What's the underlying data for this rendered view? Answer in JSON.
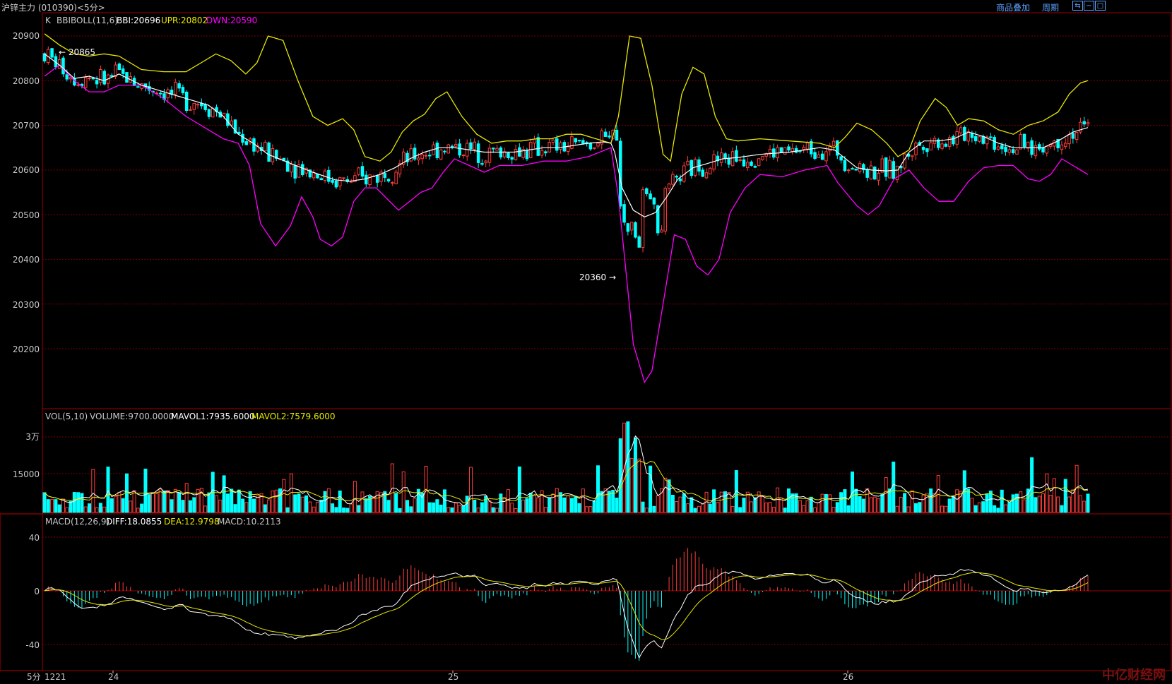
{
  "header": {
    "title": "沪锌主力 (010390)<5分>",
    "overlay_label": "商品叠加",
    "period_label": "周期"
  },
  "colors": {
    "up": "#ff3c3c",
    "down": "#00ffff",
    "bbi": "#ffffff",
    "upr": "#e8e800",
    "dwn": "#ff00ff",
    "grid": "#7a0000",
    "frame": "#a00000"
  },
  "price_panel": {
    "k_label": "K",
    "indicator": "BBIBOLL(11,6)",
    "bbi": "BBI:20696",
    "upr": "UPR:20802",
    "dwn": "DWN:20590",
    "ticks": [
      "20900",
      "20800",
      "20700",
      "20600",
      "20500",
      "20400",
      "20300",
      "20200"
    ],
    "high_mark": "20865",
    "low_mark": "20360"
  },
  "volume_panel": {
    "indicator": "VOL(5,10)",
    "volume": "VOLUME:9700.0000",
    "mavol1": "MAVOL1:7935.6000",
    "mavol2": "MAVOL2:7579.6000",
    "ticks": [
      "3万",
      "15000"
    ]
  },
  "macd_panel": {
    "indicator": "MACD(12,26,9)",
    "diff": "DIFF:18.0855",
    "dea": "DEA:12.9798",
    "macd": "MACD:10.2113",
    "ticks": [
      "40",
      "0",
      "-40"
    ]
  },
  "x_axis": {
    "period": "5分",
    "labels": [
      "1221",
      "24",
      "25",
      "26"
    ]
  },
  "watermark": "中亿财经网",
  "chart_data": {
    "type": "candlestick",
    "y_range": [
      20110,
      20995
    ],
    "bbi_path": [
      [
        0,
        20860
      ],
      [
        20,
        20835
      ],
      [
        40,
        20805
      ],
      [
        60,
        20810
      ],
      [
        80,
        20800
      ],
      [
        100,
        20815
      ],
      [
        130,
        20790
      ],
      [
        160,
        20775
      ],
      [
        190,
        20760
      ],
      [
        220,
        20745
      ],
      [
        240,
        20720
      ],
      [
        260,
        20680
      ],
      [
        280,
        20660
      ],
      [
        300,
        20635
      ],
      [
        330,
        20615
      ],
      [
        360,
        20595
      ],
      [
        390,
        20578
      ],
      [
        410,
        20575
      ],
      [
        430,
        20580
      ],
      [
        450,
        20590
      ],
      [
        470,
        20605
      ],
      [
        490,
        20625
      ],
      [
        510,
        20640
      ],
      [
        530,
        20650
      ],
      [
        550,
        20650
      ],
      [
        570,
        20645
      ],
      [
        590,
        20640
      ],
      [
        610,
        20640
      ],
      [
        630,
        20640
      ],
      [
        650,
        20645
      ],
      [
        670,
        20650
      ],
      [
        690,
        20650
      ],
      [
        710,
        20655
      ],
      [
        730,
        20660
      ],
      [
        750,
        20663
      ],
      [
        760,
        20660
      ],
      [
        765,
        20640
      ],
      [
        775,
        20560
      ],
      [
        790,
        20510
      ],
      [
        805,
        20495
      ],
      [
        820,
        20505
      ],
      [
        835,
        20540
      ],
      [
        850,
        20580
      ],
      [
        870,
        20605
      ],
      [
        890,
        20615
      ],
      [
        910,
        20625
      ],
      [
        930,
        20628
      ],
      [
        960,
        20635
      ],
      [
        1000,
        20640
      ],
      [
        1040,
        20650
      ],
      [
        1060,
        20645
      ],
      [
        1075,
        20625
      ],
      [
        1090,
        20605
      ],
      [
        1110,
        20600
      ],
      [
        1130,
        20598
      ],
      [
        1145,
        20600
      ],
      [
        1160,
        20640
      ],
      [
        1180,
        20665
      ],
      [
        1200,
        20665
      ],
      [
        1220,
        20670
      ],
      [
        1240,
        20685
      ],
      [
        1260,
        20675
      ],
      [
        1280,
        20660
      ],
      [
        1300,
        20650
      ],
      [
        1320,
        20650
      ],
      [
        1340,
        20650
      ],
      [
        1360,
        20665
      ],
      [
        1380,
        20685
      ],
      [
        1400,
        20695
      ]
    ],
    "upr_path": [
      [
        0,
        20905
      ],
      [
        20,
        20880
      ],
      [
        40,
        20860
      ],
      [
        60,
        20855
      ],
      [
        80,
        20860
      ],
      [
        100,
        20855
      ],
      [
        130,
        20825
      ],
      [
        160,
        20820
      ],
      [
        190,
        20820
      ],
      [
        210,
        20840
      ],
      [
        230,
        20860
      ],
      [
        250,
        20845
      ],
      [
        270,
        20815
      ],
      [
        285,
        20840
      ],
      [
        300,
        20900
      ],
      [
        320,
        20890
      ],
      [
        340,
        20800
      ],
      [
        360,
        20720
      ],
      [
        380,
        20700
      ],
      [
        400,
        20715
      ],
      [
        415,
        20690
      ],
      [
        430,
        20630
      ],
      [
        450,
        20620
      ],
      [
        465,
        20640
      ],
      [
        480,
        20685
      ],
      [
        495,
        20710
      ],
      [
        510,
        20725
      ],
      [
        525,
        20760
      ],
      [
        540,
        20775
      ],
      [
        560,
        20720
      ],
      [
        580,
        20680
      ],
      [
        600,
        20660
      ],
      [
        620,
        20665
      ],
      [
        640,
        20665
      ],
      [
        660,
        20670
      ],
      [
        680,
        20670
      ],
      [
        700,
        20680
      ],
      [
        720,
        20680
      ],
      [
        740,
        20670
      ],
      [
        760,
        20660
      ],
      [
        770,
        20720
      ],
      [
        785,
        20900
      ],
      [
        800,
        20895
      ],
      [
        815,
        20790
      ],
      [
        830,
        20635
      ],
      [
        840,
        20620
      ],
      [
        855,
        20770
      ],
      [
        870,
        20830
      ],
      [
        885,
        20815
      ],
      [
        900,
        20720
      ],
      [
        915,
        20670
      ],
      [
        930,
        20665
      ],
      [
        960,
        20670
      ],
      [
        1000,
        20665
      ],
      [
        1040,
        20660
      ],
      [
        1060,
        20650
      ],
      [
        1075,
        20675
      ],
      [
        1090,
        20705
      ],
      [
        1110,
        20690
      ],
      [
        1130,
        20660
      ],
      [
        1145,
        20630
      ],
      [
        1160,
        20645
      ],
      [
        1175,
        20710
      ],
      [
        1195,
        20760
      ],
      [
        1210,
        20740
      ],
      [
        1225,
        20700
      ],
      [
        1240,
        20715
      ],
      [
        1260,
        20710
      ],
      [
        1280,
        20690
      ],
      [
        1300,
        20680
      ],
      [
        1320,
        20700
      ],
      [
        1340,
        20710
      ],
      [
        1360,
        20730
      ],
      [
        1375,
        20770
      ],
      [
        1390,
        20795
      ],
      [
        1400,
        20800
      ]
    ],
    "dwn_path": [
      [
        0,
        20810
      ],
      [
        20,
        20835
      ],
      [
        40,
        20800
      ],
      [
        60,
        20775
      ],
      [
        80,
        20775
      ],
      [
        100,
        20790
      ],
      [
        130,
        20790
      ],
      [
        160,
        20760
      ],
      [
        190,
        20720
      ],
      [
        220,
        20690
      ],
      [
        240,
        20670
      ],
      [
        260,
        20660
      ],
      [
        275,
        20610
      ],
      [
        290,
        20480
      ],
      [
        310,
        20430
      ],
      [
        330,
        20475
      ],
      [
        345,
        20540
      ],
      [
        360,
        20495
      ],
      [
        370,
        20445
      ],
      [
        385,
        20430
      ],
      [
        400,
        20450
      ],
      [
        415,
        20530
      ],
      [
        430,
        20560
      ],
      [
        445,
        20560
      ],
      [
        460,
        20535
      ],
      [
        475,
        20510
      ],
      [
        490,
        20530
      ],
      [
        505,
        20550
      ],
      [
        520,
        20560
      ],
      [
        535,
        20595
      ],
      [
        550,
        20625
      ],
      [
        570,
        20610
      ],
      [
        590,
        20595
      ],
      [
        610,
        20610
      ],
      [
        640,
        20610
      ],
      [
        670,
        20620
      ],
      [
        700,
        20620
      ],
      [
        730,
        20630
      ],
      [
        760,
        20650
      ],
      [
        770,
        20540
      ],
      [
        790,
        20210
      ],
      [
        805,
        20125
      ],
      [
        815,
        20150
      ],
      [
        830,
        20300
      ],
      [
        845,
        20455
      ],
      [
        860,
        20445
      ],
      [
        875,
        20385
      ],
      [
        890,
        20365
      ],
      [
        905,
        20400
      ],
      [
        920,
        20505
      ],
      [
        940,
        20560
      ],
      [
        960,
        20590
      ],
      [
        990,
        20585
      ],
      [
        1020,
        20600
      ],
      [
        1050,
        20610
      ],
      [
        1065,
        20570
      ],
      [
        1090,
        20520
      ],
      [
        1105,
        20500
      ],
      [
        1120,
        20520
      ],
      [
        1140,
        20580
      ],
      [
        1160,
        20600
      ],
      [
        1180,
        20560
      ],
      [
        1200,
        20530
      ],
      [
        1220,
        20530
      ],
      [
        1240,
        20575
      ],
      [
        1260,
        20605
      ],
      [
        1280,
        20610
      ],
      [
        1300,
        20610
      ],
      [
        1320,
        20580
      ],
      [
        1335,
        20575
      ],
      [
        1350,
        20590
      ],
      [
        1365,
        20625
      ],
      [
        1380,
        20610
      ],
      [
        1400,
        20590
      ]
    ]
  }
}
